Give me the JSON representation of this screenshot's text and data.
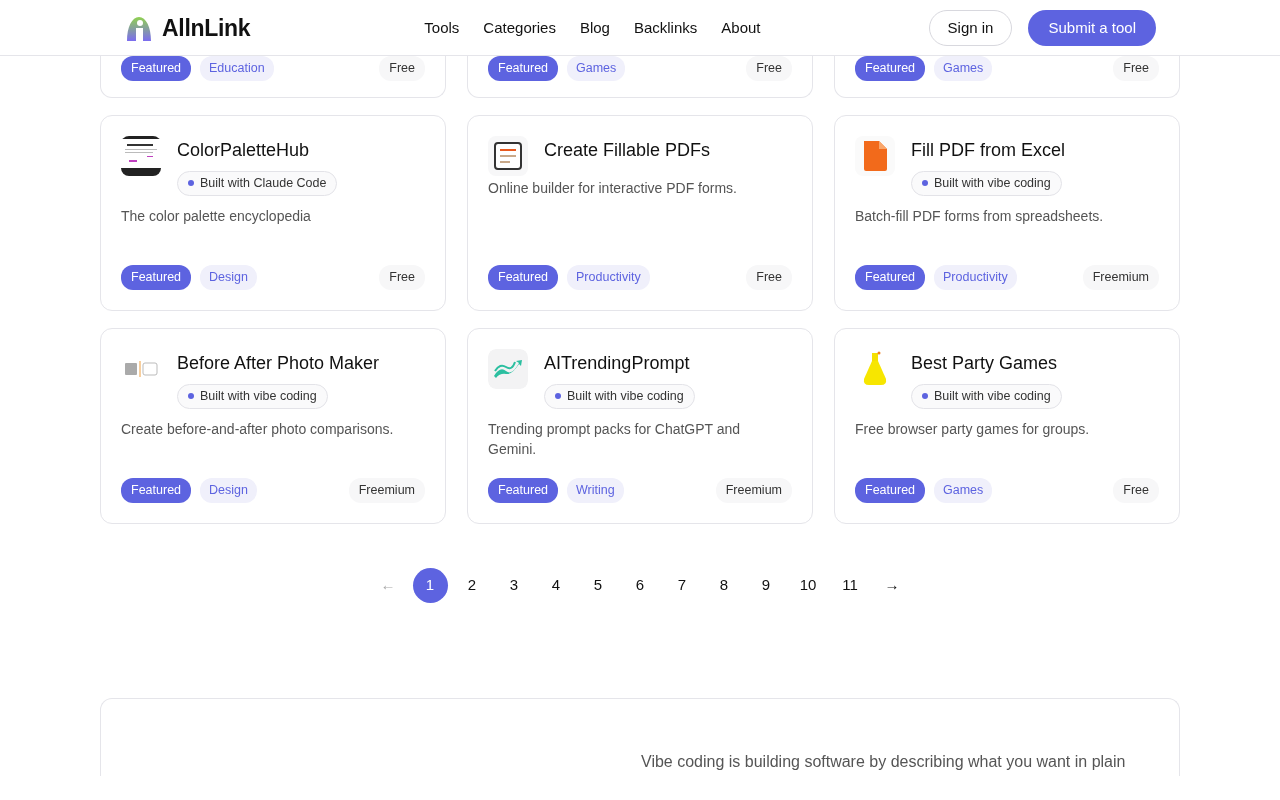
{
  "header": {
    "brand": "AllnLink",
    "nav": [
      "Tools",
      "Categories",
      "Blog",
      "Backlinks",
      "About"
    ],
    "sign_in": "Sign in",
    "submit": "Submit a tool"
  },
  "cards": [
    {
      "kind": "partial",
      "tags": [
        "Featured",
        "Education"
      ],
      "pricing": "Free"
    },
    {
      "kind": "partial",
      "tags": [
        "Featured",
        "Games"
      ],
      "pricing": "Free"
    },
    {
      "kind": "partial",
      "tags": [
        "Featured",
        "Games"
      ],
      "pricing": "Free"
    },
    {
      "kind": "full",
      "name": "ColorPaletteHub",
      "built_with": "Built with Claude Code",
      "description": "The color palette encyclopedia",
      "tags": [
        "Featured",
        "Design"
      ],
      "pricing": "Free"
    },
    {
      "kind": "full",
      "name": "Create Fillable PDFs",
      "description": "Online builder for interactive PDF forms.",
      "tags": [
        "Featured",
        "Productivity"
      ],
      "pricing": "Free"
    },
    {
      "kind": "full",
      "name": "Fill PDF from Excel",
      "built_with": "Built with vibe coding",
      "description": "Batch-fill PDF forms from spreadsheets.",
      "tags": [
        "Featured",
        "Productivity"
      ],
      "pricing": "Freemium"
    },
    {
      "kind": "full",
      "name": "Before After Photo Maker",
      "built_with": "Built with vibe coding",
      "description": "Create before-and-after photo comparisons.",
      "tags": [
        "Featured",
        "Design"
      ],
      "pricing": "Freemium"
    },
    {
      "kind": "full",
      "name": "AITrendingPrompt",
      "built_with": "Built with vibe coding",
      "description": "Trending prompt packs for ChatGPT and Gemini.",
      "tags": [
        "Featured",
        "Writing"
      ],
      "pricing": "Freemium"
    },
    {
      "kind": "full",
      "name": "Best Party Games",
      "built_with": "Built with vibe coding",
      "description": "Free browser party games for groups.",
      "tags": [
        "Featured",
        "Games"
      ],
      "pricing": "Free"
    }
  ],
  "pagination": {
    "prev": {
      "label": "←",
      "disabled": true
    },
    "pages": [
      {
        "label": "1",
        "selected": true
      },
      {
        "label": "2",
        "selected": false
      },
      {
        "label": "3",
        "selected": false
      },
      {
        "label": "4",
        "selected": false
      },
      {
        "label": "5",
        "selected": false
      },
      {
        "label": "6",
        "selected": false
      },
      {
        "label": "7",
        "selected": false
      },
      {
        "label": "8",
        "selected": false
      },
      {
        "label": "9",
        "selected": false
      },
      {
        "label": "10",
        "selected": false
      },
      {
        "label": "11",
        "selected": false
      }
    ],
    "next": {
      "label": "→",
      "disabled": false
    }
  },
  "about": {
    "text": "Vibe coding is building software by describing what you want in plain"
  }
}
